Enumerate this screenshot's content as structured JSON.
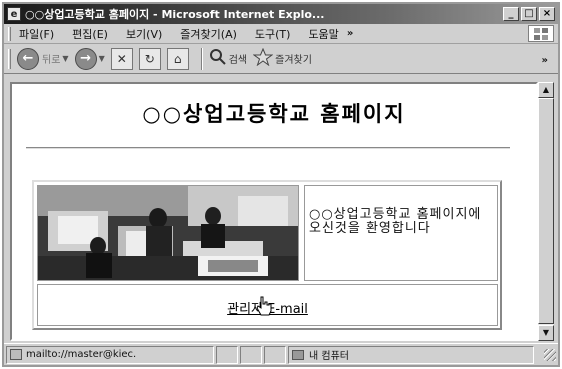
{
  "window": {
    "title": "○○상업고등학교 홈페이지 - Microsoft Internet Explo...",
    "buttons": {
      "minimize": "_",
      "maximize": "□",
      "close": "×"
    }
  },
  "menubar": {
    "items": [
      "파일(F)",
      "편집(E)",
      "보기(V)",
      "즐겨찾기(A)",
      "도구(T)",
      "도움말"
    ],
    "overflow": "»"
  },
  "toolbar": {
    "back_label": "뒤로",
    "search_label": "검색",
    "favorites_label": "즐겨찾기",
    "overflow": "»"
  },
  "page": {
    "title": "○○상업고등학교 홈페이지",
    "welcome_text": "○○상업고등학교 홈페이지에오신것을 환영합니다",
    "admin_link": "관리자 E-mail"
  },
  "statusbar": {
    "url": "mailto://master@kiec.",
    "zone": "내 컴퓨터"
  },
  "icons": {
    "back": "back-arrow-icon",
    "forward": "forward-arrow-icon",
    "stop": "stop-icon",
    "refresh": "refresh-icon",
    "home": "home-icon",
    "search": "search-icon",
    "favorites": "star-icon",
    "cursor": "hand-cursor-icon"
  }
}
